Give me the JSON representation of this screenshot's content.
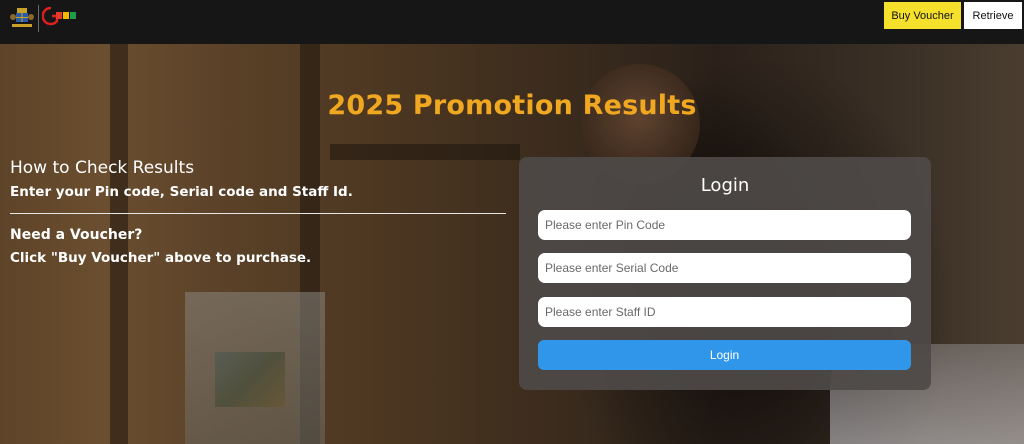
{
  "header": {
    "buy_voucher_label": "Buy Voucher",
    "retrieve_label": "Retrieve",
    "buy_voucher_color": "#f5e02c"
  },
  "hero": {
    "title": "2025 Promotion Results",
    "title_color": "#f0a820"
  },
  "instructions": {
    "title": "How to Check Results",
    "subtitle": "Enter your Pin code, Serial code and Staff Id.",
    "voucher_title": "Need a Voucher?",
    "voucher_text": "Click \"Buy Voucher\" above to purchase."
  },
  "login": {
    "title": "Login",
    "pin_placeholder": "Please enter Pin Code",
    "serial_placeholder": "Please enter Serial Code",
    "staff_placeholder": "Please enter Staff ID",
    "button_label": "Login",
    "button_color": "#2f96ea"
  }
}
